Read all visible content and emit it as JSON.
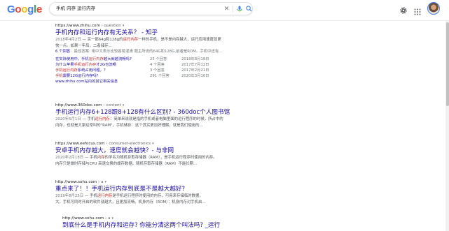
{
  "header": {
    "logo_letters": [
      {
        "ch": "G",
        "color": "#4285f4"
      },
      {
        "ch": "o",
        "color": "#ea4335"
      },
      {
        "ch": "o",
        "color": "#fbbc05"
      },
      {
        "ch": "g",
        "color": "#4285f4"
      },
      {
        "ch": "l",
        "color": "#34a853"
      },
      {
        "ch": "e",
        "color": "#ea4335"
      }
    ],
    "search_query": "手机 内存 运行内存",
    "clear_symbol": "✕"
  },
  "results": [
    {
      "url": "https://www.zhihu.com",
      "path": " › question",
      "title": "手机内存和运行内存有无关系？ - 知乎",
      "snippet1_date": "2018年4月2日",
      "snippet1_a": " — 买一部64g和128g的",
      "snippet1_hl": "运行内存",
      "snippet1_b": "一样的手机，是不是内存越大，运行应用速度就更",
      "snippet2": "快一点。如果一年后，二者储存...",
      "meta_a": "6 个回答",
      "meta_b": " · 最佳答案: 用中文表示比较容易混淆 题主所说的64G和128G,前者是ROM。手机中还有...",
      "qa": [
        {
          "q_a": "在实际使用中，手机",
          "q_hl": "运行内存",
          "q_b": "越大就越流畅吗?",
          "n": "25 个回答",
          "d": "2018年8月18日"
        },
        {
          "q_a": "为什么苹果",
          "q_hl": "手机运行内存",
          "q_b": "才2G也流畅",
          "n": "4 个回答",
          "d": "2017年7月12日"
        },
        {
          "q_a": "",
          "q_hl": "手机运行内存",
          "q_b": "系统占用问题。?",
          "n": "3 个回答",
          "d": "2017年2月21日"
        },
        {
          "q_a": "",
          "q_hl": "手机",
          "q_b": "需要12G运行内存吗?",
          "n": "291 个回答",
          "d": "2020年3月10日"
        }
      ],
      "more": "www.zhihu.com站内的其它相关信息"
    },
    {
      "url": "http://www.360doc.com",
      "path": " › content",
      "title": "手机运行内存6+128跟8+128有什么区别? - 360doc个人图书馆",
      "snippet1_date": "2020年5月1日",
      "snippet1_a": " — 手机",
      "snippet1_hl": "运行内存",
      "snippet1_b": "：简单来说就是指的手机或者电脑里面的运行程序的时候，所占中的",
      "snippet2": "内存，也就是大家经常叫的\"RAM\"，手机储存：这个其实更加好理解，就是我们使用的..."
    },
    {
      "url": "https://www.eefocus.com",
      "path": " › consumer-electronics",
      "title": "安卓手机内存越大，速度就会越快？- 与非网",
      "snippet1_date": "2020年2月18日",
      "snippet1_a": " — 手机",
      "snippet1_hl": "内存",
      "snippet1_b": "的学名为随机存取存储器（RAM），是手机运行程序时使用的内存。",
      "snippet2": "内存只是做时存储与CPU 高速交换的缓存数据。随机存取存储器（RAM）不能长期..."
    },
    {
      "url": "http://www.sohu.com",
      "path": " › a",
      "title": "重点来了！！手机运行内存到底是不是越大越好?",
      "snippet1_date": "2019年8月25日",
      "snippet1_a": " — 手机",
      "snippet1_hl": "运行内存",
      "snippet1_b": "是手机运行程序时使用的内存，可用来存储临时数据，",
      "snippet2": "大，手机可同时开启的软件就越大，且更加流畅。机身内存（ROM）：机身内存对手机启..."
    },
    {
      "url": "http://www.sohu.com",
      "path": " › a",
      "title": "到底什么是手机内存和运存? 你能分清这两个叫法吗? _运行"
    }
  ]
}
